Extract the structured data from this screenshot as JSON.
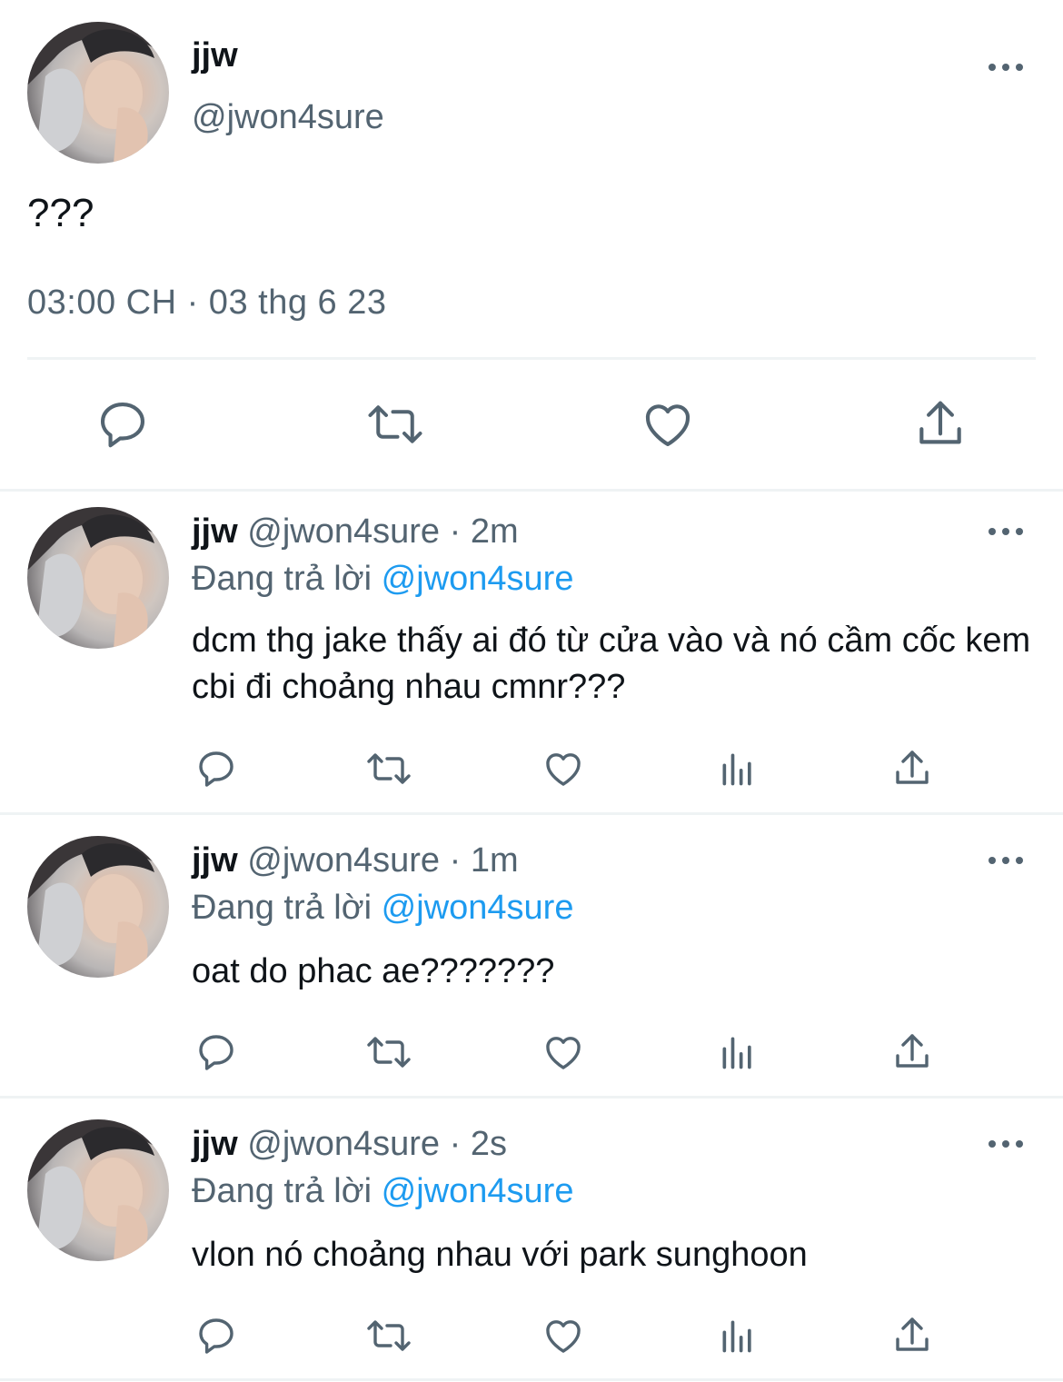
{
  "main_tweet": {
    "name": "jjw",
    "handle": "@jwon4sure",
    "text": "???",
    "timestamp": "03:00 CH · 03 thg 6 23",
    "actions": [
      "reply-icon",
      "retweet-icon",
      "like-icon",
      "share-icon"
    ]
  },
  "replies": [
    {
      "name": "jjw",
      "handle": "@jwon4sure",
      "sep": "·",
      "time": "2m",
      "replying_prefix": "Đang trả lời",
      "replying_to": "@jwon4sure",
      "text": "dcm thg jake thấy ai đó từ cửa vào và nó cầm cốc kem cbi đi choảng nhau cmnr???"
    },
    {
      "name": "jjw",
      "handle": "@jwon4sure",
      "sep": "·",
      "time": "1m",
      "replying_prefix": "Đang trả lời",
      "replying_to": "@jwon4sure",
      "text": "oat do phac ae???????"
    },
    {
      "name": "jjw",
      "handle": "@jwon4sure",
      "sep": "·",
      "time": "2s",
      "replying_prefix": "Đang trả lời",
      "replying_to": "@jwon4sure",
      "text": "vlon nó choảng nhau với park sunghoon"
    }
  ],
  "reply_actions": [
    "reply-icon",
    "retweet-icon",
    "like-icon",
    "views-icon",
    "share-icon"
  ],
  "colors": {
    "text": "#0f1419",
    "secondary": "#536471",
    "link": "#1d9bf0",
    "divider": "#eff3f4"
  }
}
